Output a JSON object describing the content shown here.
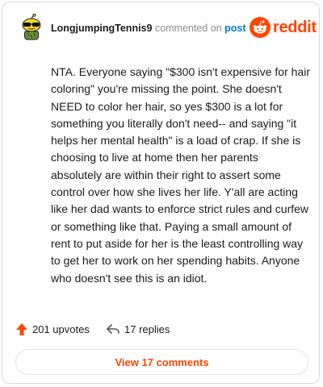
{
  "header": {
    "username": "LongjumpingTennis9",
    "action_text": "commented on",
    "post_link": "post",
    "brand_name": "reddit"
  },
  "comment": {
    "text": "NTA. Everyone saying \"$300 isn't expensive for hair coloring\" you're missing the point. She doesn't NEED to color her hair, so yes $300 is a lot for something you literally don't need-- and saying \"it helps her mental health\" is a load of crap. If she is choosing to live at home then her parents absolutely are within their right to assert some control over how she lives her life. Y'all are acting like her dad wants to enforce strict rules and curfew or something like that. Paying a small amount of rent to put aside for her is the least controlling way to get her to work on her spending habits. Anyone who doesn't see this is an idiot."
  },
  "stats": {
    "upvotes_label": "201 upvotes",
    "replies_label": "17 replies"
  },
  "view_comments_label": "View 17 comments",
  "colors": {
    "brand": "#ff4500",
    "link": "#0079d3",
    "muted": "#8a8a8a"
  },
  "icons": {
    "avatar": "snoo-avatar-sunglasses",
    "brand": "reddit-logo-icon",
    "upvote": "upvote-arrow-icon",
    "reply": "reply-arrow-icon"
  }
}
